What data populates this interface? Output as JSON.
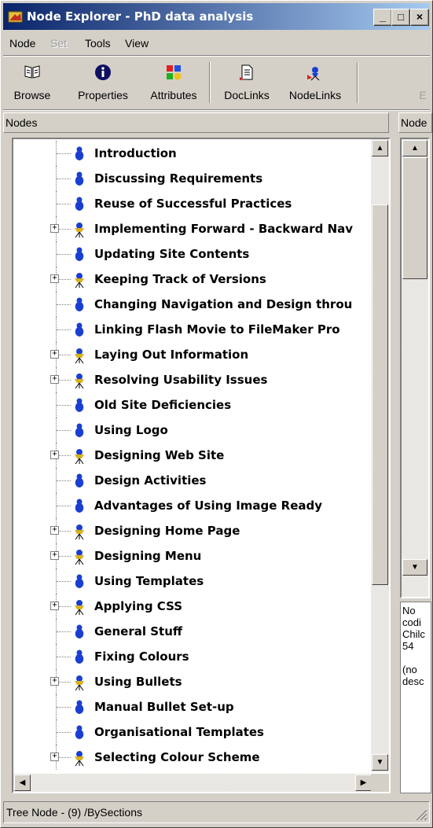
{
  "window": {
    "title": "Node Explorer - PhD data analysis",
    "minimize_glyph": "_",
    "maximize_glyph": "□",
    "close_glyph": "×"
  },
  "menu": [
    {
      "label": "Node",
      "disabled": false
    },
    {
      "label": "Set",
      "disabled": true
    },
    {
      "label": "Tools",
      "disabled": false
    },
    {
      "label": "View",
      "disabled": false
    }
  ],
  "toolbar": {
    "browse": "Browse",
    "properties": "Properties",
    "attributes": "Attributes",
    "doclinks": "DocLinks",
    "nodelinks": "NodeLinks",
    "cut_off": "E"
  },
  "panes": {
    "nodes_header": "Nodes",
    "right_header": "Node"
  },
  "tree": {
    "nodes": [
      {
        "label": "Introduction",
        "has_children": false
      },
      {
        "label": "Discussing Requirements",
        "has_children": false
      },
      {
        "label": "Reuse of Successful Practices",
        "has_children": false
      },
      {
        "label": "Implementing Forward - Backward Nav",
        "has_children": true
      },
      {
        "label": "Updating Site Contents",
        "has_children": false
      },
      {
        "label": "Keeping Track of Versions",
        "has_children": true
      },
      {
        "label": "Changing Navigation and Design throu",
        "has_children": false
      },
      {
        "label": "Linking Flash Movie to FileMaker Pro",
        "has_children": false
      },
      {
        "label": "Laying Out Information",
        "has_children": true
      },
      {
        "label": "Resolving Usability Issues",
        "has_children": true
      },
      {
        "label": "Old Site Deficiencies",
        "has_children": false
      },
      {
        "label": "Using Logo",
        "has_children": false
      },
      {
        "label": "Designing Web Site",
        "has_children": true
      },
      {
        "label": "Design Activities",
        "has_children": false
      },
      {
        "label": "Advantages of Using Image Ready",
        "has_children": false
      },
      {
        "label": "Designing Home Page",
        "has_children": true
      },
      {
        "label": "Designing Menu",
        "has_children": true
      },
      {
        "label": "Using Templates",
        "has_children": false
      },
      {
        "label": "Applying CSS",
        "has_children": true
      },
      {
        "label": "General Stuff",
        "has_children": false
      },
      {
        "label": "Fixing Colours",
        "has_children": false
      },
      {
        "label": "Using Bullets",
        "has_children": true
      },
      {
        "label": "Manual Bullet Set-up",
        "has_children": false
      },
      {
        "label": "Organisational Templates",
        "has_children": false
      },
      {
        "label": "Selecting Colour Scheme",
        "has_children": true
      }
    ]
  },
  "right_info": {
    "line1": "No",
    "line2": "codi",
    "line3": "Chilc",
    "line4": "54",
    "line5": "",
    "line6": "(no",
    "line7": "desc"
  },
  "status": {
    "text": "Tree Node - (9) /BySections"
  },
  "colors": {
    "title_start": "#0a246a",
    "title_end": "#a6caf0",
    "node_icon": "#1a3fd0",
    "node_icon_children": "#d8b020"
  }
}
